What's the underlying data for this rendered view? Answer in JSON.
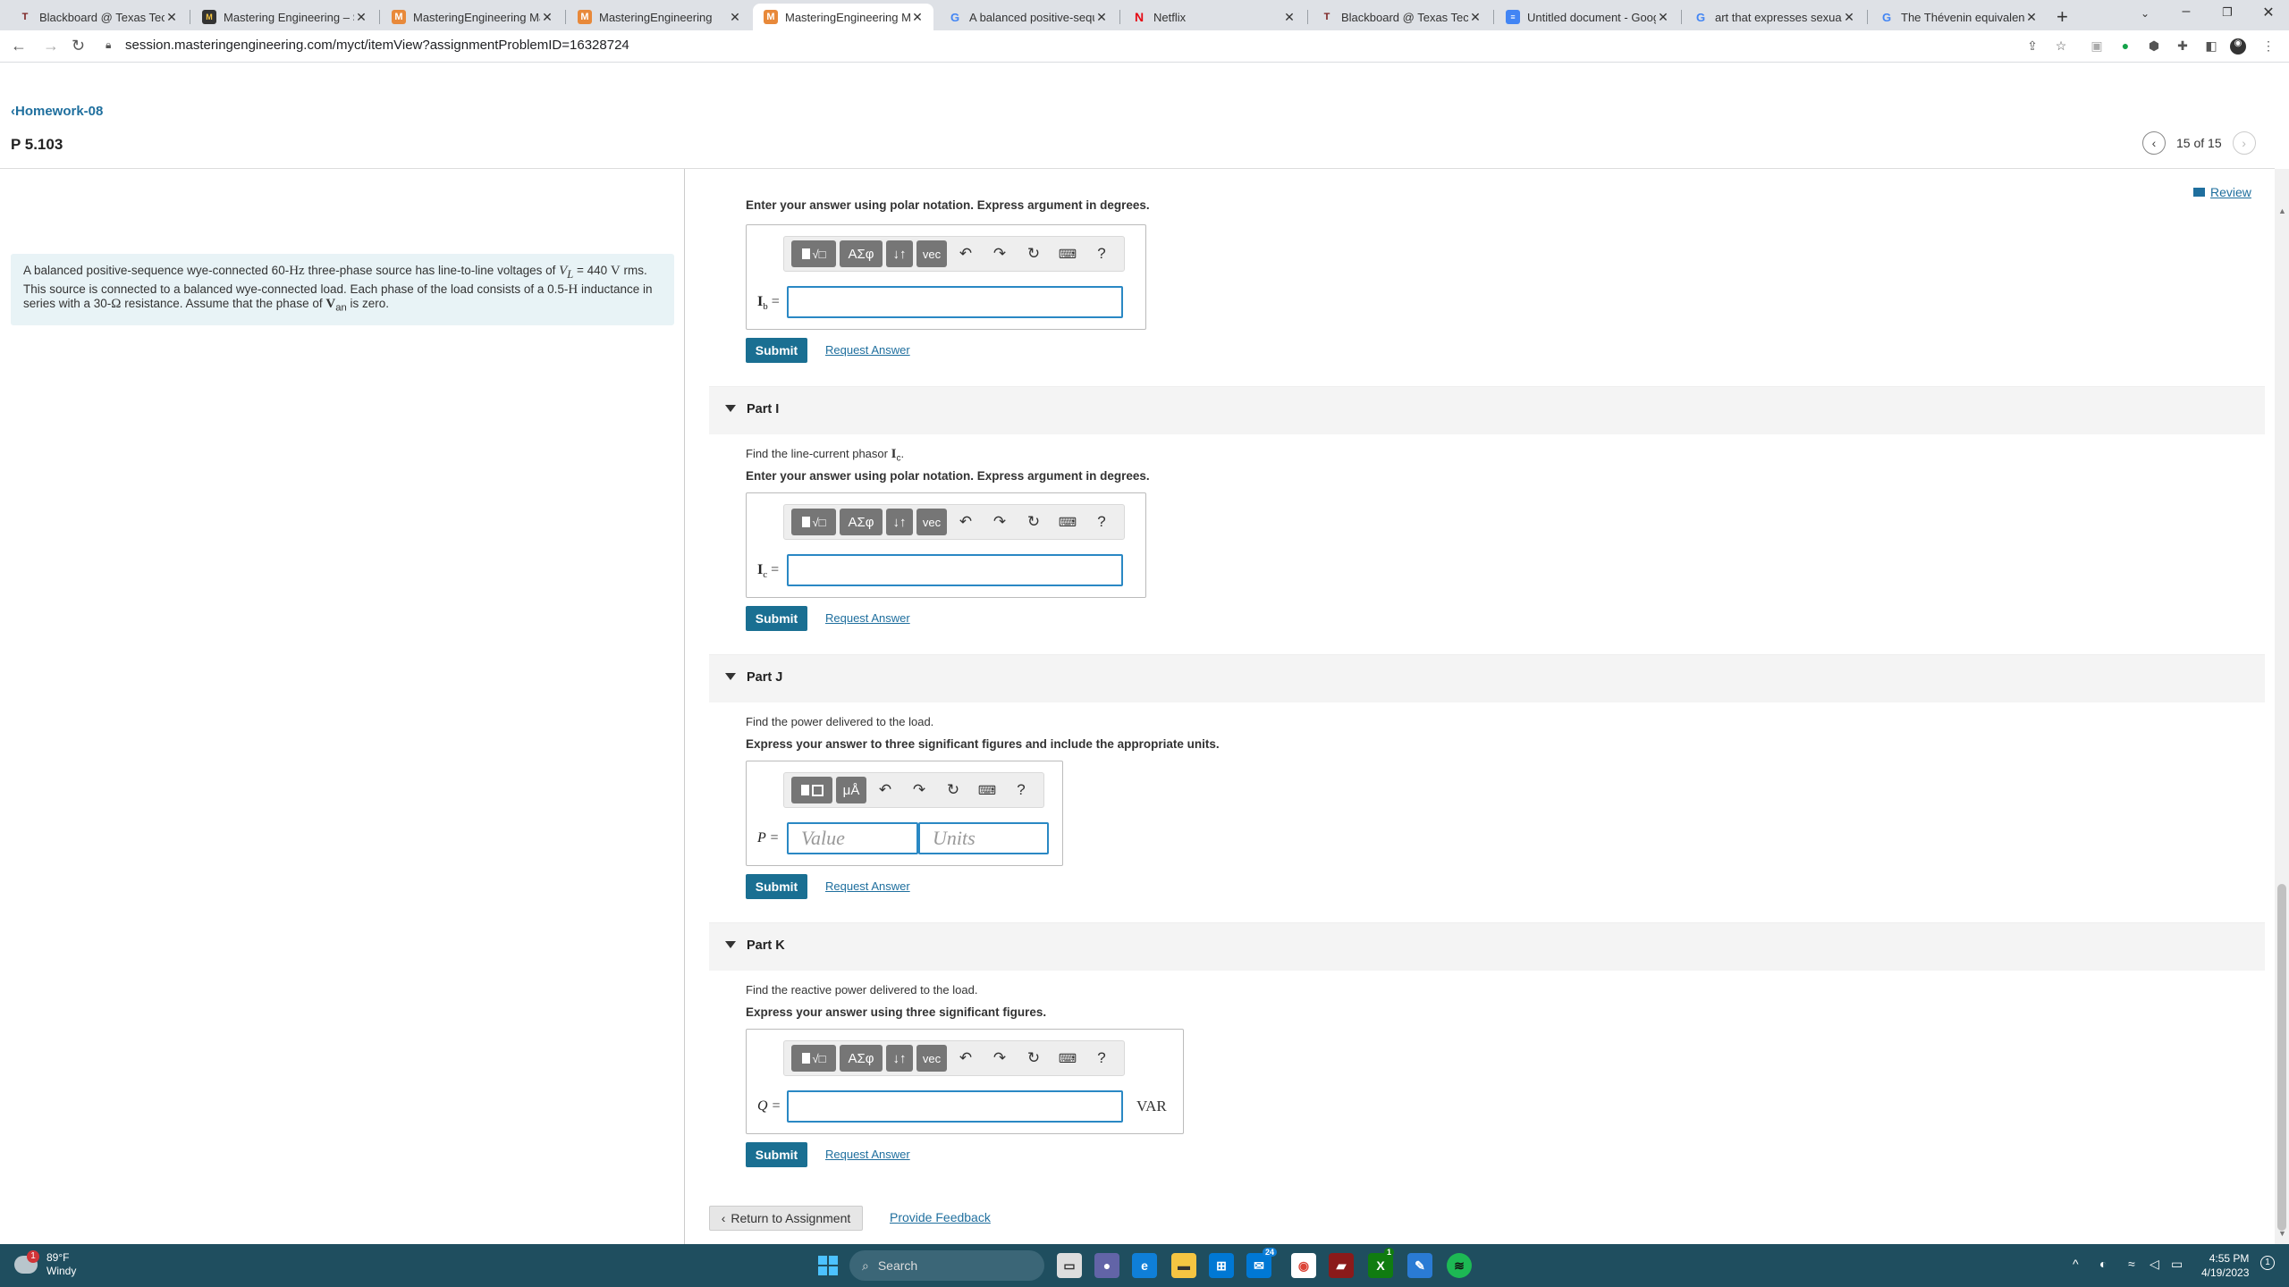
{
  "browser": {
    "tabs": [
      {
        "title": "Blackboard @ Texas Tech U",
        "icon": "blackboard-icon"
      },
      {
        "title": "Mastering Engineering – Sp",
        "icon": "mastering-icon"
      },
      {
        "title": "MasteringEngineering Mas",
        "icon": "mastering-icon"
      },
      {
        "title": "MasteringEngineering",
        "icon": "mastering-icon"
      },
      {
        "title": "MasteringEngineering Mas",
        "icon": "mastering-icon"
      },
      {
        "title": "A balanced positive-seque",
        "icon": "google-icon"
      },
      {
        "title": "Netflix",
        "icon": "netflix-icon"
      },
      {
        "title": "Blackboard @ Texas Tech U",
        "icon": "blackboard-icon"
      },
      {
        "title": "Untitled document - Goog",
        "icon": "docs-icon"
      },
      {
        "title": "art that expresses sexuality",
        "icon": "google-icon"
      },
      {
        "title": "The Thévenin equivalent of",
        "icon": "google-icon"
      }
    ],
    "active_tab": 4,
    "url": "session.masteringengineering.com/myct/itemView?assignmentProblemID=16328724"
  },
  "header": {
    "breadcrumb": "Homework-08",
    "problem": "P 5.103",
    "pager": "15 of 15"
  },
  "context": {
    "text_html": "A balanced positive-sequence wye-connected 60-<span style=\"font-family:'Liberation Serif',serif;font-size:15px\">Hz</span> three-phase source has line-to-line voltages of <i style=\"font-family:'Liberation Serif',serif;font-size:15px\">V<sub>L</sub></i> = 440 <span style=\"font-family:'Liberation Serif',serif;font-size:15px\">V</span> rms. This source is connected to a balanced wye-connected load. Each phase of the load consists of a 0.5-<span style=\"font-family:'Liberation Serif',serif;font-size:15px\">H</span> inductance in series with a 30-<span style=\"font-family:'Liberation Serif',serif;font-size:15px\">Ω</span> resistance. Assume that the phase of <b style=\"font-family:'Liberation Serif',serif;font-size:15px\">V</b><sub>an</sub> is zero."
  },
  "review": "Review",
  "top_instruction": "Enter your answer using polar notation. Express argument in degrees.",
  "toolbar": {
    "greek": "ΑΣφ",
    "arrows": "↓↑",
    "vec": "vec",
    "units": "μÅ",
    "help": "?"
  },
  "parts": {
    "h": {
      "label_main": "I",
      "label_sub": "b",
      "label_eq": " ="
    },
    "i": {
      "title": "Part I",
      "prompt_pre": "Find the line-current phasor ",
      "prompt_sym": "I",
      "prompt_sub": "c",
      "prompt_post": ".",
      "instruction": "Enter your answer using polar notation. Express argument in degrees.",
      "label_main": "I",
      "label_sub": "c",
      "label_eq": " ="
    },
    "j": {
      "title": "Part J",
      "prompt": "Find the power delivered to the load.",
      "instruction": "Express your answer to three significant figures and include the appropriate units.",
      "label": "P =",
      "value_placeholder": "Value",
      "units_placeholder": "Units"
    },
    "k": {
      "title": "Part K",
      "prompt": "Find the reactive power delivered to the load.",
      "instruction": "Express your answer using three significant figures.",
      "label": "Q =",
      "unit": "VAR"
    }
  },
  "buttons": {
    "submit": "Submit",
    "request": "Request Answer",
    "return": "Return to Assignment",
    "feedback": "Provide Feedback"
  },
  "taskbar": {
    "weather_temp": "89°F",
    "weather_desc": "Windy",
    "weather_badge": "1",
    "search": "Search",
    "mail_badge": "24",
    "xbox_badge": "1",
    "time": "4:55 PM",
    "date": "4/19/2023",
    "notif": "1"
  },
  "colors": {
    "accent": "#1a6f92",
    "link": "#1f6f9e",
    "context_bg": "#e8f3f6",
    "taskbar": "#1f4e5f"
  }
}
